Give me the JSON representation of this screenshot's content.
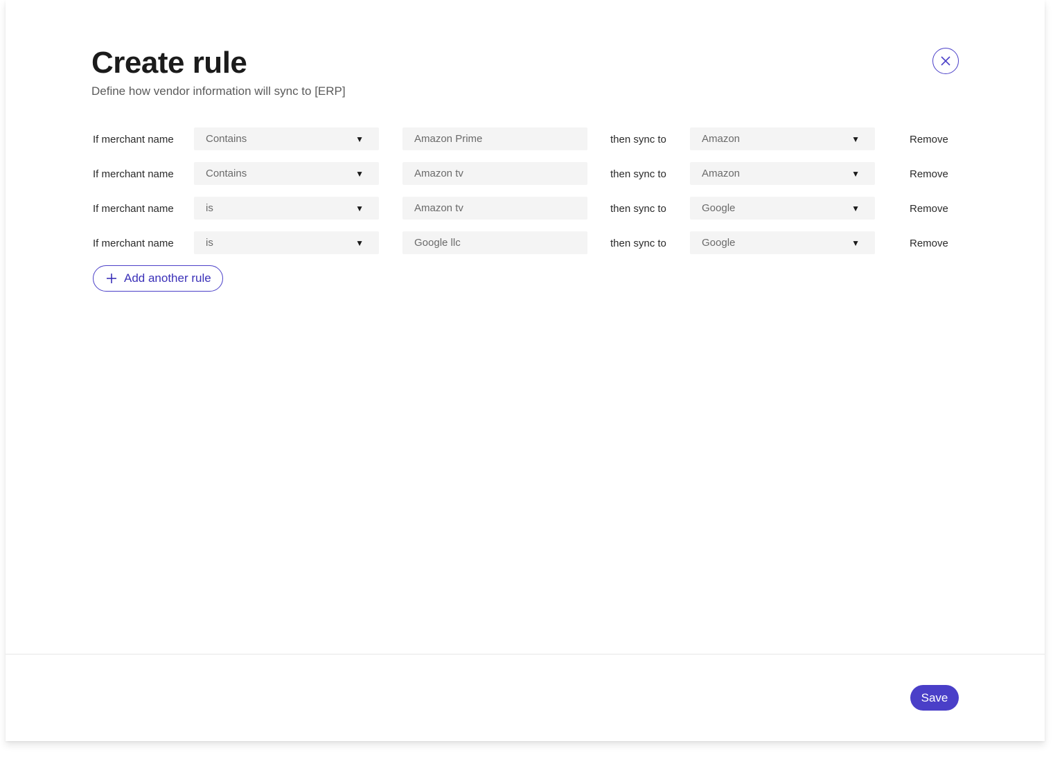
{
  "header": {
    "title": "Create rule",
    "subtitle": "Define how vendor information will sync to [ERP]"
  },
  "rules": [
    {
      "label": "If merchant name",
      "operator": "Contains",
      "value": "Amazon Prime",
      "sync_label": "then sync to",
      "target": "Amazon",
      "remove_label": "Remove"
    },
    {
      "label": "If merchant name",
      "operator": "Contains",
      "value": "Amazon tv",
      "sync_label": "then sync to",
      "target": "Amazon",
      "remove_label": "Remove"
    },
    {
      "label": "If merchant name",
      "operator": "is",
      "value": "Amazon tv",
      "sync_label": "then sync to",
      "target": "Google",
      "remove_label": "Remove"
    },
    {
      "label": "If merchant name",
      "operator": "is",
      "value": "Google llc",
      "sync_label": "then sync to",
      "target": "Google",
      "remove_label": "Remove"
    }
  ],
  "actions": {
    "add_rule_label": "Add another rule",
    "save_label": "Save"
  },
  "icons": {
    "close": "close-icon",
    "plus": "plus-icon",
    "caret": "caret-down-icon"
  },
  "colors": {
    "accent": "#4a3fc8",
    "field_bg": "#f4f4f4"
  }
}
